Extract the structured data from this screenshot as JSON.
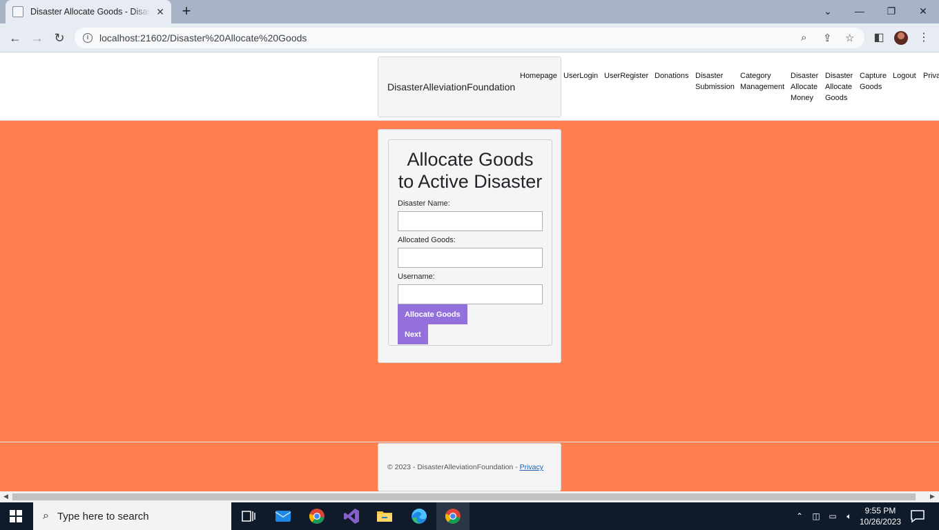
{
  "browser": {
    "tab_title": "Disaster Allocate Goods - Disaster",
    "tab_close": "✕",
    "new_tab": "+",
    "url": "localhost:21602/Disaster%20Allocate%20Goods",
    "window_controls": {
      "dropdown": "⌄",
      "minimize": "—",
      "restore": "❐",
      "close": "✕"
    }
  },
  "site": {
    "brand": "DisasterAlleviationFoundation",
    "nav": [
      "Homepage",
      "UserLogin",
      "UserRegister",
      "Donations",
      "Disaster Submission",
      "Category Management",
      "Disaster Allocate Money",
      "Disaster Allocate Goods",
      "Capture Goods",
      "Logout",
      "Privacy"
    ]
  },
  "form": {
    "title": "Allocate Goods to Active Disaster",
    "disaster_name_label": "Disaster Name:",
    "disaster_name_value": "",
    "allocated_goods_label": "Allocated Goods:",
    "allocated_goods_value": "",
    "username_label": "Username:",
    "username_value": "",
    "allocate_button": "Allocate Goods",
    "next_button": "Next"
  },
  "footer": {
    "text": "© 2023 - DisasterAlleviationFoundation - ",
    "privacy_link": "Privacy"
  },
  "taskbar": {
    "search_placeholder": "Type here to search",
    "time": "9:55 PM",
    "date": "10/26/2023"
  },
  "colors": {
    "page_background": "#ff7f4f",
    "button_background": "#9370db",
    "card_background": "#f5f5f5"
  }
}
